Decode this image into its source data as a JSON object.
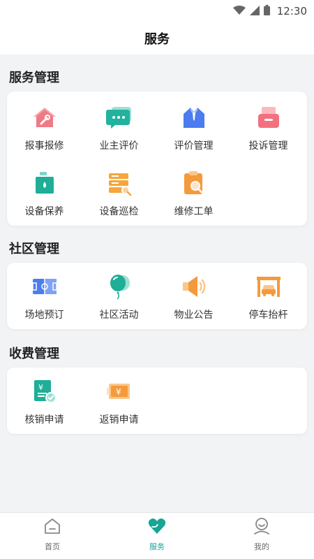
{
  "status": {
    "time": "12:30"
  },
  "header": {
    "title": "服务"
  },
  "sections": [
    {
      "title": "服务管理",
      "items": [
        {
          "label": "报事报修",
          "icon": "house-wrench-icon"
        },
        {
          "label": "业主评价",
          "icon": "chat-bubble-icon"
        },
        {
          "label": "评价管理",
          "icon": "shirt-collar-icon"
        },
        {
          "label": "投诉管理",
          "icon": "complaint-box-icon"
        },
        {
          "label": "设备保养",
          "icon": "oil-can-icon"
        },
        {
          "label": "设备巡检",
          "icon": "server-search-icon"
        },
        {
          "label": "维修工单",
          "icon": "clipboard-search-icon"
        }
      ]
    },
    {
      "title": "社区管理",
      "items": [
        {
          "label": "场地预订",
          "icon": "sports-field-icon"
        },
        {
          "label": "社区活动",
          "icon": "balloon-icon"
        },
        {
          "label": "物业公告",
          "icon": "speaker-icon"
        },
        {
          "label": "停车抬杆",
          "icon": "parking-car-icon"
        }
      ]
    },
    {
      "title": "收费管理",
      "items": [
        {
          "label": "核销申请",
          "icon": "receipt-check-icon"
        },
        {
          "label": "返销申请",
          "icon": "yuan-bill-icon"
        }
      ]
    }
  ],
  "tabs": [
    {
      "label": "首页",
      "icon": "home-icon"
    },
    {
      "label": "服务",
      "icon": "heart-hands-icon"
    },
    {
      "label": "我的",
      "icon": "user-icon"
    }
  ],
  "colors": {
    "accent": "#16a596",
    "tab_inactive": "#666666"
  }
}
